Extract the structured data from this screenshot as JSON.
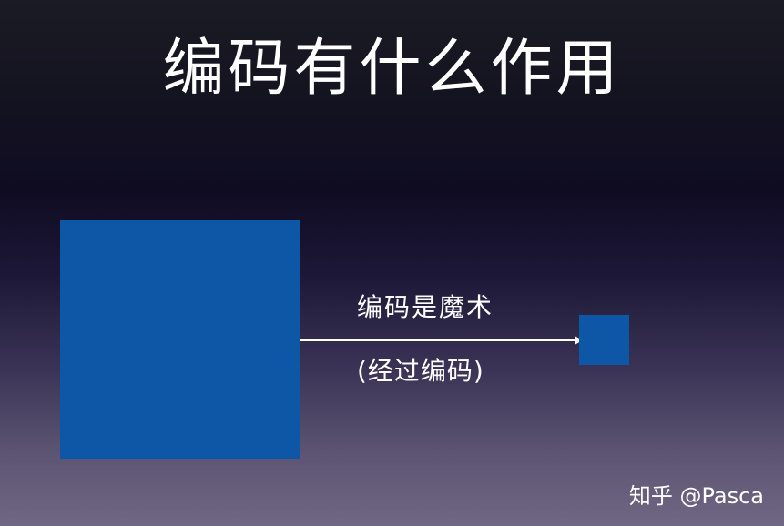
{
  "title": "编码有什么作用",
  "diagram": {
    "arrow_label": "编码是魔术",
    "arrow_sublabel": "(经过编码)",
    "colors": {
      "square_fill": "#0d57a6",
      "arrow_stroke": "#ffffff"
    }
  },
  "watermark": "知乎 @Pasca"
}
